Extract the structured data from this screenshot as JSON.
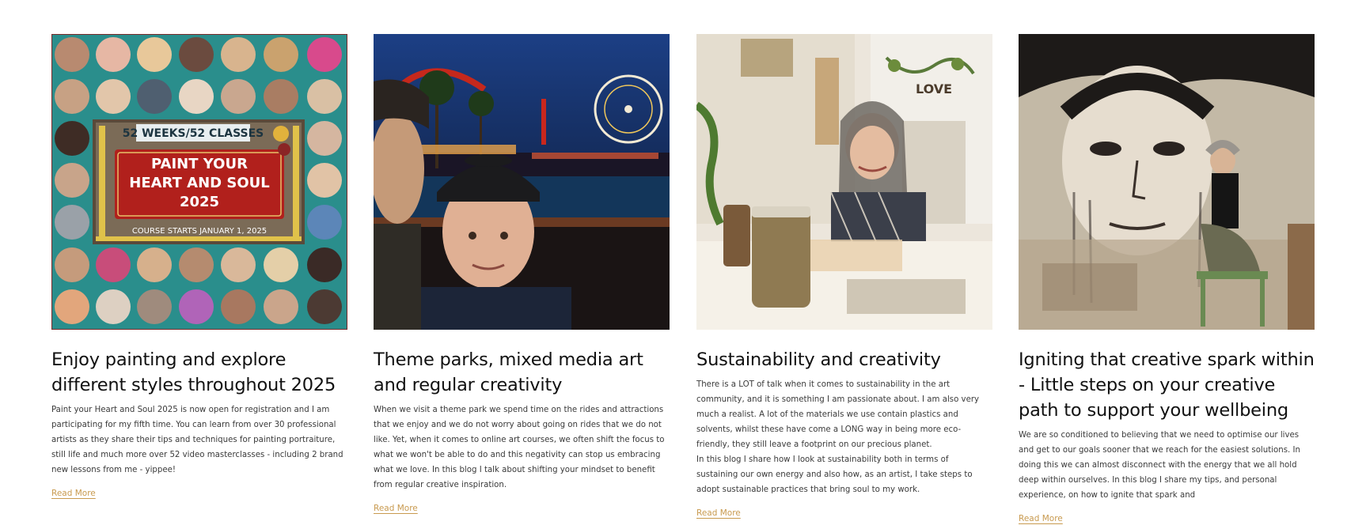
{
  "posts": [
    {
      "image_alt": "Paint Your Heart and Soul 2025 course poster",
      "image_text": {
        "badge": "52 WEEKS/52 CLASSES",
        "line1": "PAINT YOUR",
        "line2": "HEART AND SOUL",
        "line3": "2025",
        "footer": "COURSE STARTS JANUARY 1, 2025"
      },
      "title": "Enjoy painting and explore different styles throughout 2025",
      "excerpt": "Paint your Heart and Soul 2025 is now open for registration and I am participating for my fifth time. You can learn from over 30 professional artists as they share their tips and techniques for painting portraiture, still life and much more over 52 video masterclasses - including 2 brand new lessons from me - yippee!",
      "read_more": "Read More"
    },
    {
      "image_alt": "Selfie at a theme park at night",
      "title": "Theme parks, mixed media art and regular creativity",
      "excerpt": "When we visit a theme park we spend time on the rides and attractions that we enjoy and we do not worry about going on rides that we do not like. Yet, when it comes to online art courses, we often shift the focus to what we won't be able to do and this negativity can stop us embracing what we love. In this blog I talk about shifting your mindset to benefit from regular creative inspiration.",
      "read_more": "Read More"
    },
    {
      "image_alt": "Artist smiling in her studio",
      "image_text": {
        "sign": "LOVE"
      },
      "title": "Sustainability and creativity",
      "excerpt": "There is a LOT of talk when it comes to sustainability in the art community, and it is something I am passionate about. I am also very much a realist. A lot of the materials we use contain plastics and solvents, whilst these have come a LONG way in being more eco-friendly, they still leave a footprint on our precious planet.\nIn this blog I share how I look at sustainability both in terms of sustaining our own energy and also how, as an artist, I take steps to adopt sustainable practices that bring soul to my work.",
      "read_more": "Read More"
    },
    {
      "image_alt": "Artist crouching in front of a large mixed media portrait",
      "title": "Igniting that creative spark within - Little steps on your creative path to support your wellbeing",
      "excerpt": "We are so conditioned to believing that we need to optimise our lives and get to our goals sooner that we reach for the easiest solutions. In doing this we can almost disconnect with the energy that we all hold deep within ourselves. In this blog I share my tips, and personal experience, on how to ignite that spark and",
      "read_more": "Read More"
    }
  ],
  "colors": {
    "title": "#111111",
    "excerpt": "#3a3a3a",
    "read_more": "#c89a4f",
    "poster_teal": "#2a8e8c",
    "poster_red": "#b1201c",
    "poster_gold": "#d9a53a"
  }
}
